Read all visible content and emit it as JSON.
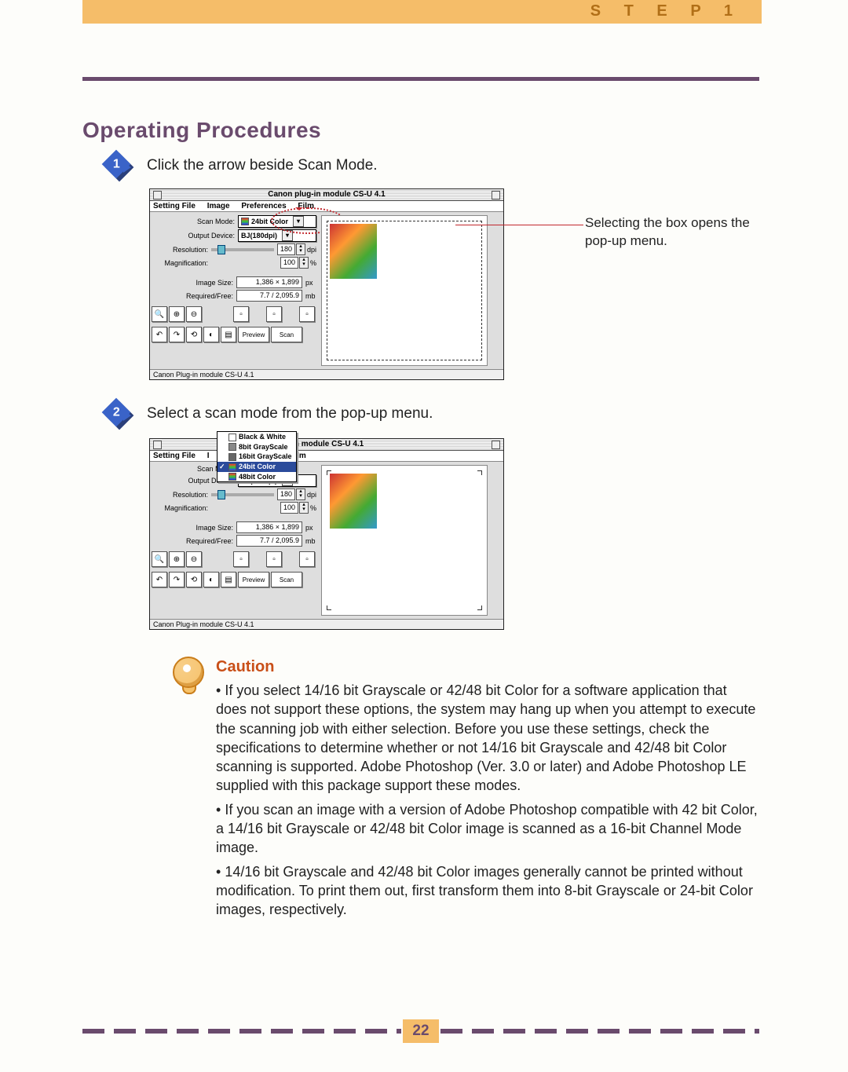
{
  "header": {
    "step_label": "S T E P   1"
  },
  "title": "Operating Procedures",
  "steps": [
    {
      "num": "1",
      "text": "Click the arrow beside Scan Mode."
    },
    {
      "num": "2",
      "text": "Select a scan mode from the pop-up menu."
    }
  ],
  "callout": "Selecting the box opens the pop-up menu.",
  "plugin": {
    "title": "Canon plug-in module CS-U 4.1",
    "menus": [
      "Setting File",
      "Image",
      "Preferences",
      "Film"
    ],
    "status": "Canon Plug-in module CS-U 4.1",
    "fields": {
      "scan_mode_label": "Scan Mode:",
      "scan_mode_value": "24bit Color",
      "output_device_label": "Output Device:",
      "output_device_value": "BJ(180dpi)",
      "resolution_label": "Resolution:",
      "resolution_value": "180",
      "resolution_unit": "dpi",
      "magnification_label": "Magnification:",
      "magnification_value": "100",
      "magnification_unit": "%",
      "image_size_label": "Image Size:",
      "image_size_value": "1,386 × 1,899",
      "image_size_unit": "px",
      "required_label": "Required/Free:",
      "required_value": "7.7 / 2,095.9",
      "required_unit": "mb"
    },
    "buttons": {
      "preview": "Preview",
      "scan": "Scan"
    }
  },
  "popup_items": [
    "Black & White",
    "8bit GrayScale",
    "16bit GrayScale",
    "24bit Color",
    "48bit Color"
  ],
  "popup_selected_index": 3,
  "caution": {
    "heading": "Caution",
    "bullets": [
      "If you select 14/16 bit Grayscale or 42/48 bit Color for a software application that does not support these options, the system may hang up when you attempt to execute the scanning job with either selection. Before you use these settings, check the specifications to determine whether or not 14/16 bit Grayscale and 42/48 bit Color scanning is supported. Adobe Photoshop (Ver. 3.0 or later) and Adobe Photoshop LE supplied with this package support these modes.",
      "If you scan an image with a version of Adobe Photoshop compatible with 42 bit Color, a 14/16 bit Grayscale or 42/48 bit Color image is scanned as a 16-bit Channel Mode image.",
      "14/16 bit Grayscale and 42/48 bit Color images generally cannot be printed without modification. To print them out, first transform them into 8-bit Grayscale or 24-bit Color images, respectively."
    ]
  },
  "page_number": "22"
}
